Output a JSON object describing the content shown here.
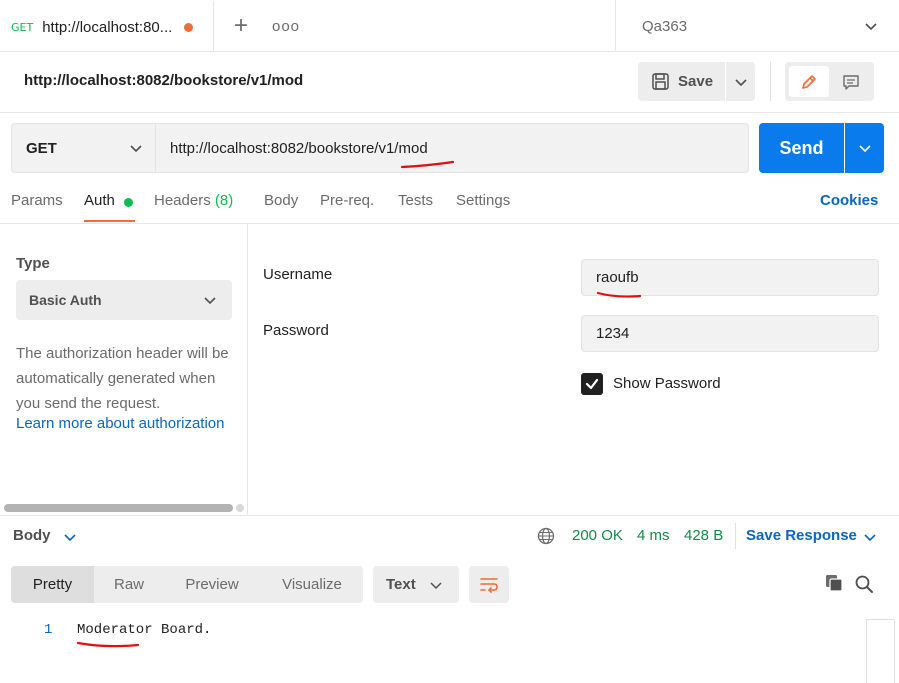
{
  "tabs": {
    "active": {
      "method": "GET",
      "url": "http://localhost:80...",
      "unsaved": true
    },
    "new_tab_symbol": "+",
    "more_symbol": "ooo"
  },
  "environment": {
    "name": "Qa363"
  },
  "request": {
    "title": "http://localhost:8082/bookstore/v1/mod",
    "save_label": "Save",
    "method": "GET",
    "url": "http://localhost:8082/bookstore/v1/mod",
    "send_label": "Send"
  },
  "request_tabs": {
    "params": "Params",
    "auth": "Auth",
    "headers": "Headers",
    "headers_count": "(8)",
    "body": "Body",
    "prereq": "Pre-req.",
    "tests": "Tests",
    "settings": "Settings",
    "cookies": "Cookies"
  },
  "auth": {
    "type_label": "Type",
    "type_value": "Basic Auth",
    "description": "The authorization header will be automatically generated when you send the request.",
    "learn_more": "Learn more about authorization",
    "username_label": "Username",
    "username_value": "raoufb",
    "password_label": "Password",
    "password_value": "1234",
    "show_password_label": "Show Password",
    "show_password_checked": true
  },
  "response": {
    "body_label": "Body",
    "status": "200 OK",
    "time": "4 ms",
    "size": "428 B",
    "save_response": "Save Response",
    "views": [
      "Pretty",
      "Raw",
      "Preview",
      "Visualize"
    ],
    "active_view": "Pretty",
    "format": "Text",
    "lines": [
      {
        "num": "1",
        "text": "Moderator Board."
      }
    ]
  },
  "colors": {
    "accent_orange": "#f26b3a",
    "send_blue": "#097bed",
    "link_blue": "#0b66c3",
    "success_green": "#168a45",
    "annotation_red": "#e01010"
  },
  "icons": [
    "plus-icon",
    "more-icon",
    "chevron-down-icon",
    "save-icon",
    "pencil-icon",
    "comment-icon",
    "globe-icon",
    "wrap-lines-icon",
    "copy-icon",
    "search-icon",
    "checkmark-icon"
  ]
}
